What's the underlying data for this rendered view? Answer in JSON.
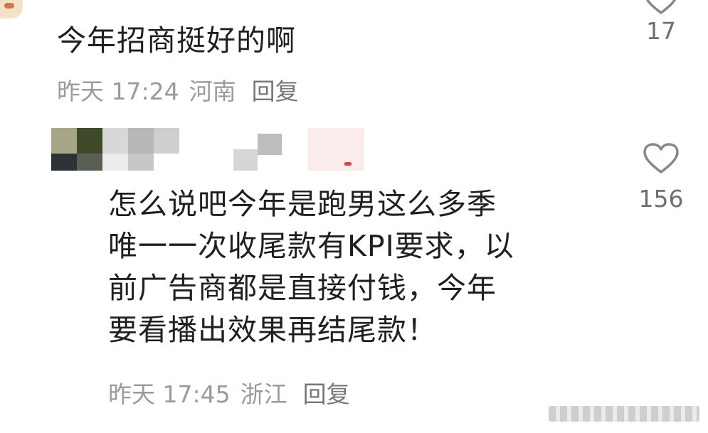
{
  "comment_1": {
    "text": "今年招商挺好的啊",
    "time": "昨天 17:24",
    "location": "河南",
    "reply_label": "回复",
    "like_count": "17"
  },
  "comment_2": {
    "username": "",
    "lines": [
      "怎么说吧今年是跑男这么多季",
      "唯一一次收尾款有KPI要求，以",
      "前广告商都是直接付钱，今年",
      "要看播出效果再结尾款！"
    ],
    "time": "昨天 17:45",
    "location": "浙江",
    "reply_label": "回复",
    "like_count": "156"
  },
  "colors": {
    "text": "#1f1f1f",
    "meta": "#9b9b9b",
    "like": "#6e6e6e"
  },
  "icons": [
    "heart-icon",
    "chevron-down-icon"
  ]
}
